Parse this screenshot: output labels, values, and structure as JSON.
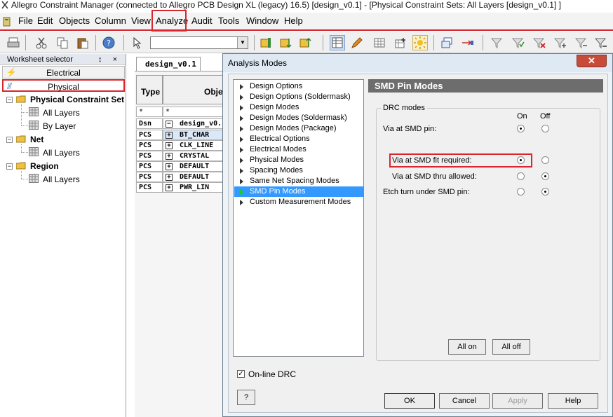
{
  "window": {
    "title": "Allegro Constraint Manager (connected to Allegro PCB Design XL (legacy) 16.5) [design_v0.1] - [Physical Constraint Sets:  All Layers [design_v0.1] ]"
  },
  "menu": {
    "items": [
      {
        "label": "File"
      },
      {
        "label": "Edit"
      },
      {
        "label": "Objects"
      },
      {
        "label": "Column"
      },
      {
        "label": "View"
      },
      {
        "label": "Analyze"
      },
      {
        "label": "Audit"
      },
      {
        "label": "Tools"
      },
      {
        "label": "Window"
      },
      {
        "label": "Help"
      }
    ],
    "highlighted": "Analyze"
  },
  "worksheet_selector": {
    "title": "Worksheet selector",
    "pin_icons": "↕ ×",
    "tabs": [
      {
        "label": "Electrical"
      },
      {
        "label": "Physical"
      }
    ],
    "tree": {
      "pcs": "Physical Constraint Set",
      "pcs_all": "All Layers",
      "pcs_by": "By Layer",
      "net": "Net",
      "net_all": "All Layers",
      "region": "Region",
      "region_all": "All Layers"
    }
  },
  "worksheet": {
    "tab": "design_v0.1",
    "headers": {
      "type": "Type",
      "objects": "Obje"
    },
    "filter": {
      "type": "*",
      "objects": "*"
    },
    "rows": [
      {
        "type": "Dsn",
        "name": "design_v0."
      },
      {
        "type": "PCS",
        "name": "BT_CHAR"
      },
      {
        "type": "PCS",
        "name": "CLK_LINE"
      },
      {
        "type": "PCS",
        "name": "CRYSTAL"
      },
      {
        "type": "PCS",
        "name": "DEFAULT"
      },
      {
        "type": "PCS",
        "name": "DEFAULT"
      },
      {
        "type": "PCS",
        "name": "PWR_LIN"
      }
    ]
  },
  "dialog": {
    "title": "Analysis Modes",
    "close_label": "✕",
    "categories": [
      {
        "label": "Design Options"
      },
      {
        "label": "Design Options (Soldermask)"
      },
      {
        "label": "Design Modes"
      },
      {
        "label": "Design Modes (Soldermask)"
      },
      {
        "label": "Design Modes (Package)"
      },
      {
        "label": "Electrical Options"
      },
      {
        "label": "Electrical Modes"
      },
      {
        "label": "Physical Modes"
      },
      {
        "label": "Spacing Modes"
      },
      {
        "label": "Same Net Spacing Modes"
      },
      {
        "label": "SMD Pin Modes"
      },
      {
        "label": "Custom Measurement Modes"
      }
    ],
    "selected_category": "SMD Pin Modes",
    "panel_title": "SMD Pin Modes",
    "group_label": "DRC modes",
    "col_on": "On",
    "col_off": "Off",
    "options": [
      {
        "label": "Via at SMD pin:",
        "value": "On"
      },
      {
        "label": "Via at SMD fit required:",
        "value": "On"
      },
      {
        "label": "Via at SMD thru allowed:",
        "value": "Off"
      },
      {
        "label": "Etch turn under SMD pin:",
        "value": "Off"
      }
    ],
    "all_on_label": "All on",
    "all_off_label": "All off",
    "online_drc_label": "On-line DRC",
    "online_drc_checked": true,
    "help_q_label": "?",
    "ok_label": "OK",
    "cancel_label": "Cancel",
    "apply_label": "Apply",
    "help_label": "Help"
  },
  "colors": {
    "highlight_red": "#d8262c",
    "selection_blue": "#3399ff",
    "panel_header_gray": "#6d6d6d"
  }
}
